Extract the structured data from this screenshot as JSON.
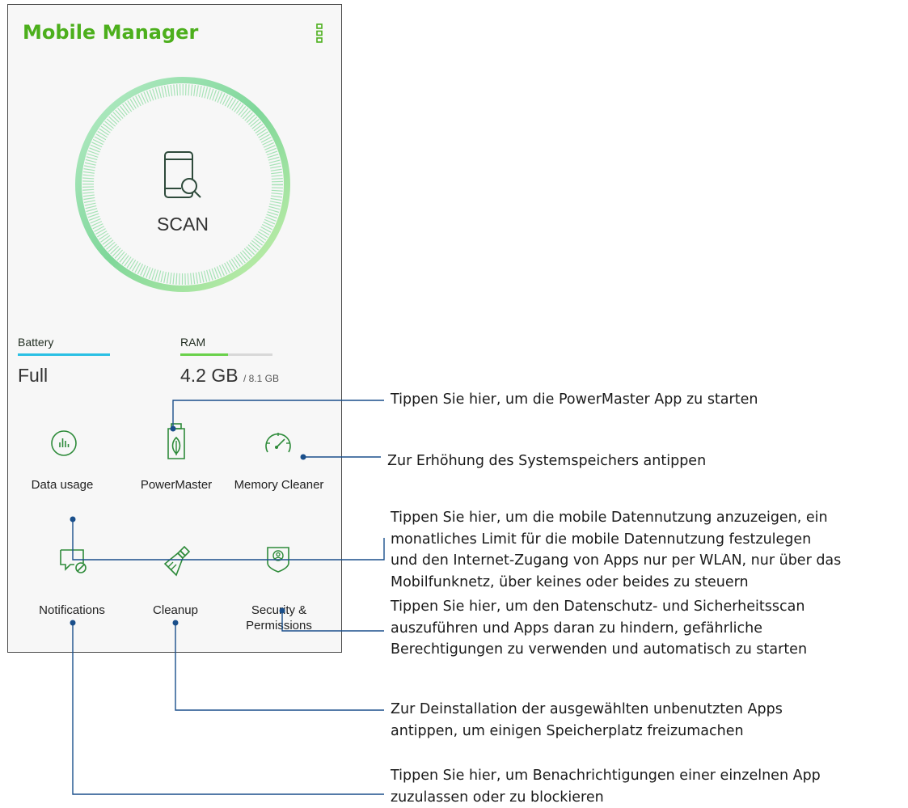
{
  "app": {
    "title": "Mobile Manager",
    "menu_icon": "vertical-dots-icon",
    "accent_color": "#4caf1c"
  },
  "scan": {
    "label": "SCAN",
    "icon": "phone-search-icon"
  },
  "stats": {
    "battery": {
      "label": "Battery",
      "value": "Full",
      "level": 1.0,
      "color": "#2bc0e4"
    },
    "ram": {
      "label": "RAM",
      "value": "4.2 GB",
      "total": "/ 8.1 GB",
      "used_fraction": 0.52,
      "color": "#6ad14b"
    }
  },
  "tools": [
    {
      "label": "Data usage",
      "icon": "data-usage-icon"
    },
    {
      "label": "PowerMaster",
      "icon": "battery-leaf-icon"
    },
    {
      "label": "Memory Cleaner",
      "icon": "speedometer-icon"
    },
    {
      "label": "Notifications",
      "icon": "notification-block-icon"
    },
    {
      "label": "Cleanup",
      "icon": "broom-icon"
    },
    {
      "label": "Security &",
      "label_line2": "Permissions",
      "icon": "shield-user-icon"
    }
  ],
  "callouts": {
    "powermaster": [
      "Tippen Sie hier, um die PowerMaster App zu starten"
    ],
    "memory_cleaner": [
      "Zur Erhöhung des Systemspeichers antippen"
    ],
    "data_usage": [
      "Tippen Sie hier, um die mobile Datennutzung anzuzeigen, ein",
      "monatliches Limit für die mobile Datennutzung festzulegen",
      "und den Internet-Zugang von Apps nur per WLAN, nur über das",
      "Mobilfunknetz, über keines oder beides zu steuern"
    ],
    "security": [
      "Tippen Sie hier, um den Datenschutz- und Sicherheitsscan",
      "auszuführen und Apps daran zu hindern, gefährliche",
      "Berechtigungen zu verwenden und automatisch zu starten"
    ],
    "cleanup": [
      "Zur Deinstallation der ausgewählten unbenutzten Apps",
      "antippen, um einigen Speicherplatz freizumachen"
    ],
    "notifications": [
      "Tippen Sie hier, um Benachrichtigungen einer einzelnen App",
      "zuzulassen oder zu blockieren"
    ],
    "line_color": "#1a4f8b"
  }
}
